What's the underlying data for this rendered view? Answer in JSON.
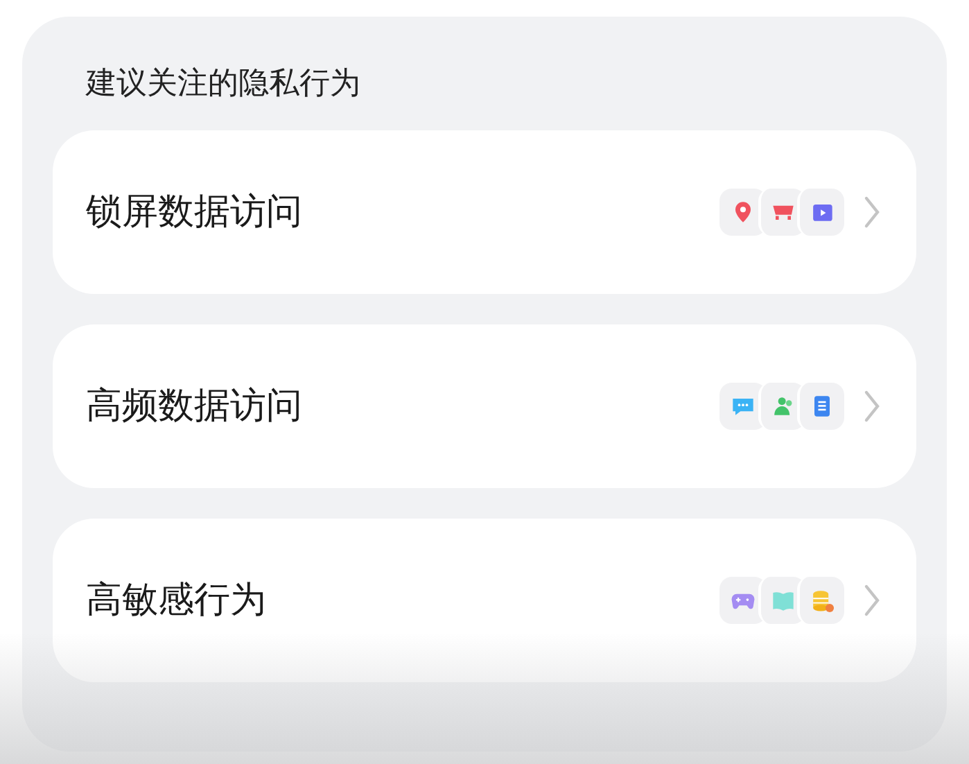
{
  "section_title": "建议关注的隐私行为",
  "items": [
    {
      "label": "锁屏数据访问"
    },
    {
      "label": "高频数据访问"
    },
    {
      "label": "高敏感行为"
    }
  ]
}
